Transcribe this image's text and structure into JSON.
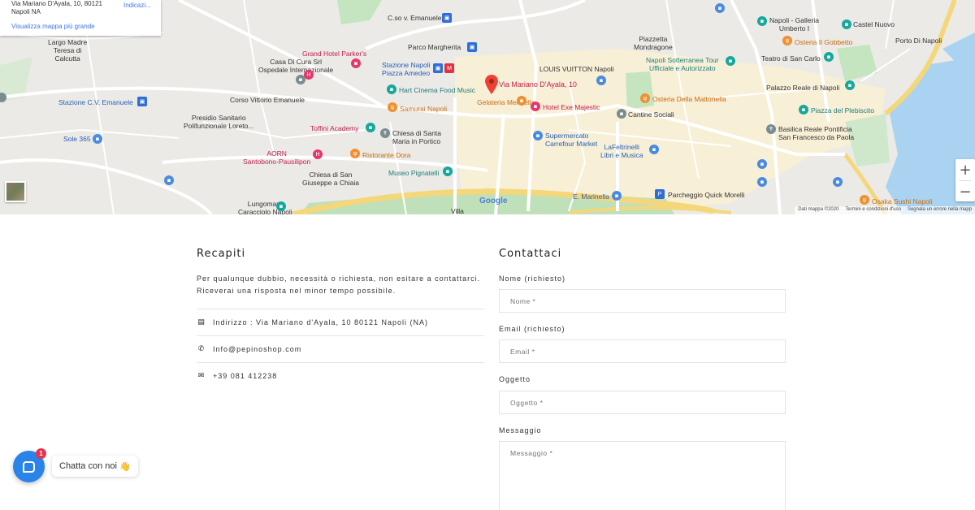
{
  "map": {
    "card": {
      "address_line1": "Via Mariano D'Ayala, 10, 80121",
      "address_line2": "Napoli NA",
      "directions": "Indicazi...",
      "larger_map": "Visualizza mappa più grande"
    },
    "pin_label": "Via Mariano D'Ayala, 10",
    "google": "Google",
    "footer": [
      "Dati mappa ©2020",
      "Termini e condizioni d'uso",
      "Segnala un errore nella mapp"
    ],
    "zoom_in": "+",
    "zoom_out": "−",
    "labels": {
      "largo": "Largo Madre\nTeresa di\nCalcutta",
      "casa_di_cura": "Casa Di Cura Srl\nOspedale Internazionale",
      "grand_hotel": "Grand Hotel Parker's",
      "stazione_amedeo": "Stazione Napoli\nPiazza Amedeo",
      "parco_margherita": "Parco Margherita",
      "cso_emanuele": "C.so v. Emanuele",
      "piazzetta": "Piazzetta\nMondragone",
      "louis_vuitton": "LOUIS VUITTON Napoli",
      "napoli_sotterranea": "Napoli Sotterranea Tour\nUfficiale e Autorizzato",
      "galleria": "Napoli - Galleria\nUmberto I",
      "osteria_gobbetto": "Osteria Il Gobbetto",
      "castel_nuovo": "Castel Nuovo",
      "porto": "Porto Di Napoli",
      "teatro": "Teatro di San Carlo",
      "palazzo_reale": "Palazzo Reale di Napoli",
      "piazza_plebiscito": "Piazza del Plebiscito",
      "basilica": "Basilica Reale Pontificia\nSan Francesco da Paola",
      "osteria_mattonella": "Osteria Della Mattonella",
      "cantine": "Cantine Sociali",
      "hart": "Hart Cinema Food Music",
      "samurai": "Samurai Napoli",
      "gelateria": "Gelateria Mennella",
      "hotel_exe": "Hotel Exe Majestic",
      "stazione_cv": "Stazione C.V. Emanuele",
      "corso_vittorio": "Corso Vittorio Emanuele",
      "presidio": "Presidio Sanitario\nPolifunzionale Loreto...",
      "toffini": "Toffini Academy",
      "chiesa_santa_maria": "Chiesa di Santa\nMaria in Portico",
      "supermercato": "Supermercato\nCarrefour Market",
      "lafeltrinelli": "LaFeltrinelli\nLibri e Musica",
      "sole": "Sole 365",
      "aorn": "AORN\nSantobono-Pausilipon",
      "ristorante_dora": "Ristorante Dora",
      "museo": "Museo Pignatelli",
      "chiesa_giuseppe": "Chiesa di San\nGiuseppe a Chiaia",
      "e_marinella": "E. Marinella",
      "parcheggio": "Parcheggio Quick Morelli",
      "osaka": "Osaka Sushi Napoli",
      "lungomare": "Lungomare\nCaracciolo Napoli",
      "villa": "Villa"
    }
  },
  "recapiti": {
    "title": "Recapiti",
    "intro_line1": "Per qualunque dubbio, necessità o richiesta, non esitare a contattarci.",
    "intro_line2": "Riceverai una risposta nel minor tempo possibile.",
    "address": "Indirizzo : Via Mariano d'Ayala, 10 80121 Napoli (NA)",
    "email": "Info@pepinoshop.com",
    "phone": "+39 081 412238"
  },
  "contattaci": {
    "title": "Contattaci",
    "name_label": "Nome (richiesto)",
    "name_placeholder": "Nome *",
    "email_label": "Email (richiesto)",
    "email_placeholder": "Email *",
    "subject_label": "Oggetto",
    "subject_placeholder": "Oggetto *",
    "message_label": "Messaggio",
    "message_placeholder": "Messaggio *"
  },
  "chat": {
    "badge": "1",
    "tooltip": "Chatta con noi",
    "emoji": "👋"
  }
}
